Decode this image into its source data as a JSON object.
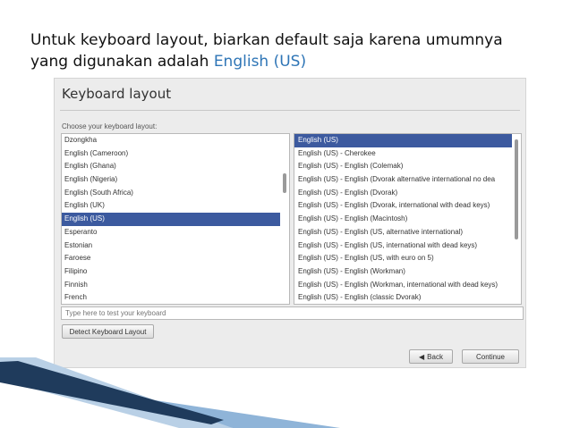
{
  "slide": {
    "line1": "Untuk keyboard layout, biarkan default saja karena umumnya",
    "line2_prefix": "yang digunakan adalah ",
    "line2_accent": "English (US)"
  },
  "dialog": {
    "title": "Keyboard layout",
    "choose_label": "Choose your keyboard layout:",
    "left_list": [
      "Dzongkha",
      "English (Cameroon)",
      "English (Ghana)",
      "English (Nigeria)",
      "English (South Africa)",
      "English (UK)",
      "English (US)",
      "Esperanto",
      "Estonian",
      "Faroese",
      "Filipino",
      "Finnish",
      "French"
    ],
    "left_selected": 6,
    "right_list": [
      "English (US)",
      "English (US) - Cherokee",
      "English (US) - English (Colemak)",
      "English (US) - English (Dvorak alternative international no dea",
      "English (US) - English (Dvorak)",
      "English (US) - English (Dvorak, international with dead keys)",
      "English (US) - English (Macintosh)",
      "English (US) - English (US, alternative international)",
      "English (US) - English (US, international with dead keys)",
      "English (US) - English (US, with euro on 5)",
      "English (US) - English (Workman)",
      "English (US) - English (Workman, international with dead keys)",
      "English (US) - English (classic Dvorak)"
    ],
    "right_selected": 0,
    "test_placeholder": "Type here to test your keyboard",
    "detect_button": "Detect Keyboard Layout",
    "back_button": "Back",
    "continue_button": "Continue"
  },
  "colors": {
    "accent_text": "#2e75b6",
    "selection": "#3c5a9f",
    "deco_dark": "#1f3b5c",
    "deco_light": "#8fb4d8"
  }
}
